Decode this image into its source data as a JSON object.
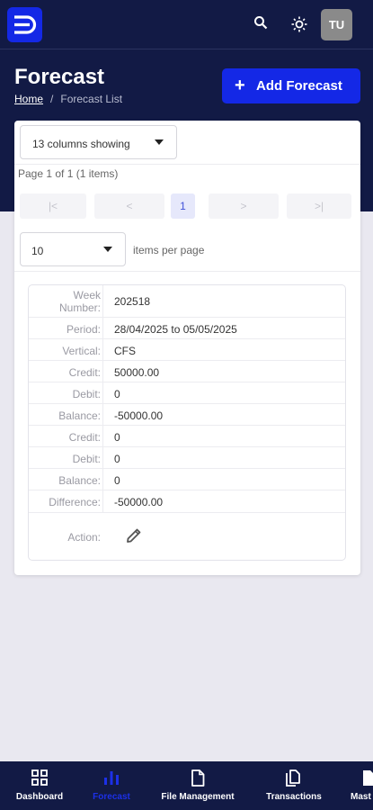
{
  "header": {
    "title": "Forecast",
    "breadcrumb_home": "Home",
    "breadcrumb_separator": "/",
    "breadcrumb_current": "Forecast List",
    "add_button_label": "Add Forecast",
    "avatar_initials": "TU"
  },
  "table_controls": {
    "columns_select_value": "13 columns showing",
    "page_info": "Page 1 of 1 (1 items)",
    "pager": {
      "first": "|<",
      "prev": "<",
      "current": "1",
      "next": ">",
      "last": ">|"
    },
    "page_size_value": "10",
    "per_page_label": "items per page"
  },
  "record": {
    "rows": [
      {
        "label": "Week Number:",
        "value": "202518"
      },
      {
        "label": "Period:",
        "value": "28/04/2025 to 05/05/2025"
      },
      {
        "label": "Vertical:",
        "value": "CFS"
      },
      {
        "label": "Credit:",
        "value": "50000.00"
      },
      {
        "label": "Debit:",
        "value": "0"
      },
      {
        "label": "Balance:",
        "value": "-50000.00"
      },
      {
        "label": "Credit:",
        "value": "0"
      },
      {
        "label": "Debit:",
        "value": "0"
      },
      {
        "label": "Balance:",
        "value": "0"
      },
      {
        "label": "Difference:",
        "value": "-50000.00"
      }
    ],
    "action_label": "Action:"
  },
  "bottom_nav": {
    "items": [
      {
        "label": "Dashboard",
        "icon": "dashboard-icon",
        "active": false
      },
      {
        "label": "Forecast",
        "icon": "bar-chart-icon",
        "active": true
      },
      {
        "label": "File Management",
        "icon": "file-icon",
        "active": false
      },
      {
        "label": "Transactions",
        "icon": "copy-icon",
        "active": false
      },
      {
        "label": "Mast",
        "icon": "document-icon",
        "active": false
      }
    ]
  },
  "colors": {
    "navy": "#121a45",
    "accent_blue": "#1428e6",
    "active_nav": "#1c30e8",
    "page_bg": "#e9e8f0"
  }
}
